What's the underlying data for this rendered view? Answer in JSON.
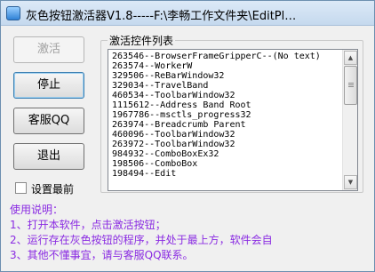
{
  "window": {
    "title": "灰色按钮激活器V1.8-----F:\\李畅工作文件夹\\EditPl…"
  },
  "buttons": {
    "activate": "激活",
    "stop": "停止",
    "support_qq": "客服QQ",
    "exit": "退出"
  },
  "checkbox": {
    "label": "设置最前",
    "checked": false
  },
  "activated_list": {
    "title": "激活控件列表",
    "items": [
      "263546--BrowserFrameGripperC--(No text)",
      "263574--WorkerW",
      "329506--ReBarWindow32",
      "329034--TravelBand",
      "460534--ToolbarWindow32",
      "1115612--Address Band Root",
      "1967786--msctls_progress32",
      "263974--Breadcrumb Parent",
      "460096--ToolbarWindow32",
      "263972--ToolbarWindow32",
      "984932--ComboBoxEx32",
      "198506--ComboBox",
      "198494--Edit"
    ]
  },
  "usage": {
    "title": "使用说明：",
    "lines": [
      "1、打开本软件，点击激活按钮；",
      "2、运行存在灰色按钮的程序，并处于最上方，软件会自",
      "3、其他不懂事宜，请与客服QQ联系。"
    ]
  },
  "colors": {
    "usage_text": "#8a2be2",
    "titlebar": "#c5d9ee"
  }
}
